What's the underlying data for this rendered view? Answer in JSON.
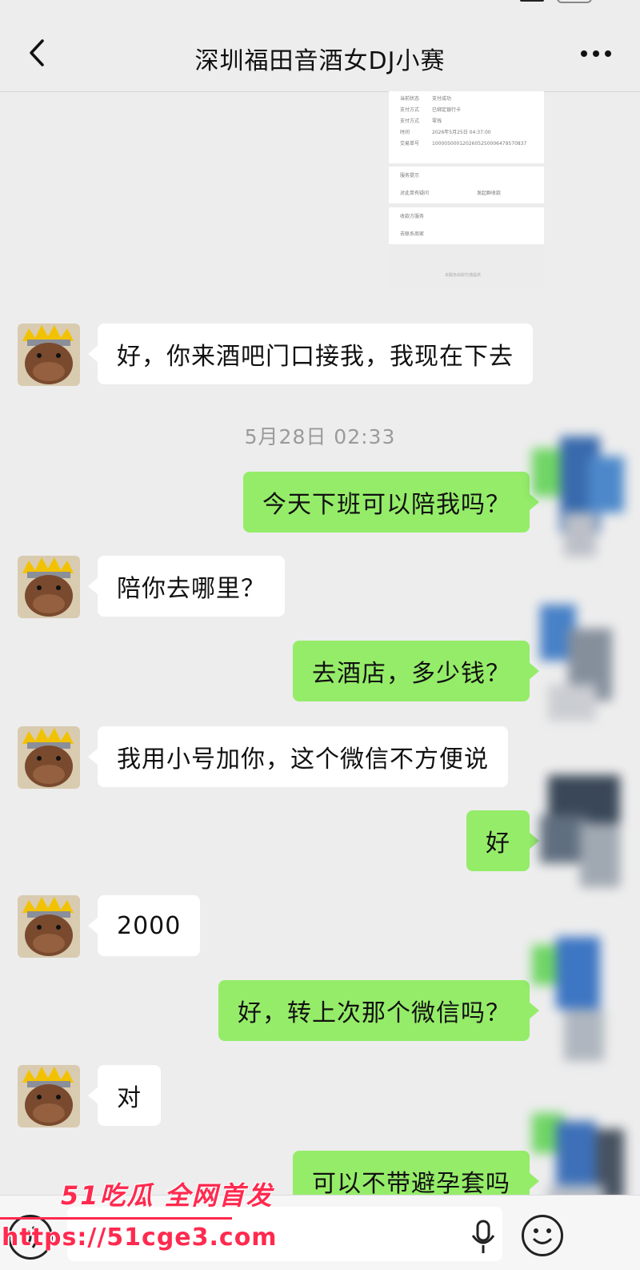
{
  "nav": {
    "title": "深圳福田音酒女DJ小赛",
    "back_icon": "chevron-left-icon",
    "more_icon": "more-dots-icon"
  },
  "attachment": {
    "rows": [
      {
        "k": "当前状态",
        "v": "支付成功"
      },
      {
        "k": "支付方式",
        "v": "已绑定银行卡"
      },
      {
        "k": "支付方式",
        "v": "零钱"
      },
      {
        "k": "时间",
        "v": "2026年5月25日 04:37:00"
      },
      {
        "k": "交易单号",
        "v": "1000050001202605250006479570837"
      }
    ],
    "section1_title": "服务提示",
    "section1_items": [
      "对此单有疑问",
      "发起群收款"
    ],
    "section2_title": "收款方服务",
    "section2_item": "去联系商家",
    "footer": "本服务由财付通提供"
  },
  "timestamp": "5月28日 02:33",
  "messages": [
    {
      "side": "left",
      "text": "好，你来酒吧门口接我，我现在下去"
    },
    {
      "side": "right",
      "text": "今天下班可以陪我吗？"
    },
    {
      "side": "left",
      "text": "陪你去哪里？"
    },
    {
      "side": "right",
      "text": "去酒店，多少钱？"
    },
    {
      "side": "left",
      "text": "我用小号加你，这个微信不方便说"
    },
    {
      "side": "right",
      "text": "好"
    },
    {
      "side": "left",
      "text": "2000"
    },
    {
      "side": "right",
      "text": "好，转上次那个微信吗？"
    },
    {
      "side": "left",
      "text": "对"
    },
    {
      "side": "right",
      "text": "可以不带避孕套吗"
    }
  ],
  "input_bar": {
    "voice_icon": "voice-toggle-icon",
    "mic_icon": "microphone-icon",
    "emoji_icon": "emoji-icon",
    "placeholder": ""
  },
  "watermark": {
    "brand": "51吃瓜 全网首发",
    "url": "https://51cge3.com"
  },
  "colors": {
    "background": "#ededed",
    "bubble_right": "#95ec69",
    "bubble_left": "#ffffff",
    "watermark": "#ff2a4f"
  }
}
